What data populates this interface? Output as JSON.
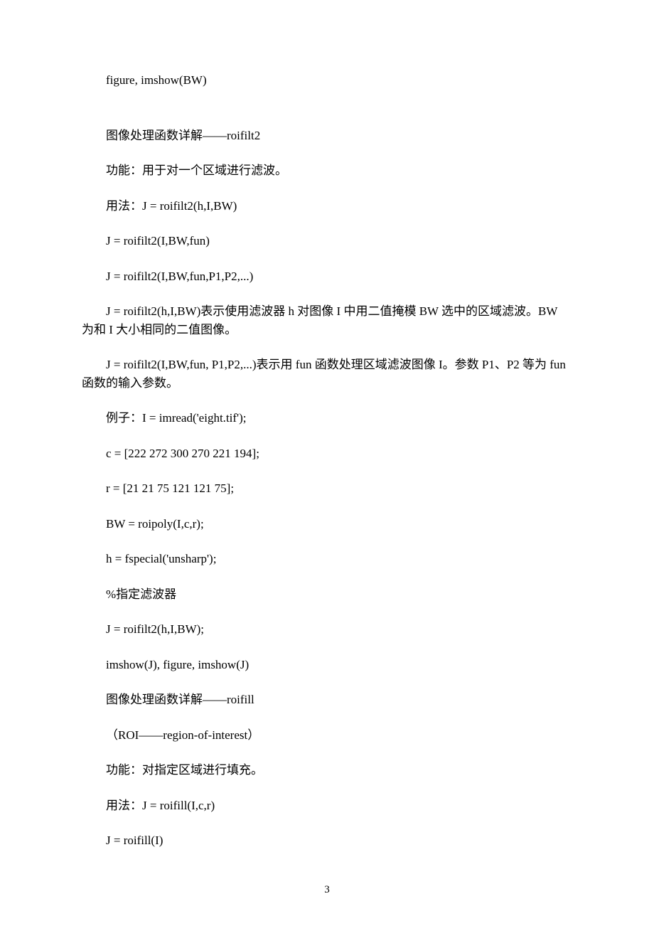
{
  "lines": {
    "l1": "figure, imshow(BW)",
    "l2": "图像处理函数详解——roifilt2",
    "l3": "功能：用于对一个区域进行滤波。",
    "l4": "用法：J = roifilt2(h,I,BW)",
    "l5": "J = roifilt2(I,BW,fun)",
    "l6": "J = roifilt2(I,BW,fun,P1,P2,...)",
    "l7": "J = roifilt2(h,I,BW)表示使用滤波器 h 对图像 I 中用二值掩模 BW 选中的区域滤波。BW 为和 I 大小相同的二值图像。",
    "l8": "J = roifilt2(I,BW,fun, P1,P2,...)表示用 fun 函数处理区域滤波图像 I。参数 P1、P2 等为 fun 函数的输入参数。",
    "l9": "例子：I = imread('eight.tif');",
    "l10": "c = [222 272 300 270 221 194];",
    "l11": "r = [21 21 75 121 121 75];",
    "l12": "BW = roipoly(I,c,r);",
    "l13": "h = fspecial('unsharp');",
    "l14": "%指定滤波器",
    "l15": "J = roifilt2(h,I,BW);",
    "l16": "imshow(J), figure, imshow(J)",
    "l17": "图像处理函数详解——roifill",
    "l18": "（ROI——region-of-interest）",
    "l19": "功能：对指定区域进行填充。",
    "l20": "用法：J = roifill(I,c,r)",
    "l21": "J = roifill(I)"
  },
  "pageNumber": "3"
}
